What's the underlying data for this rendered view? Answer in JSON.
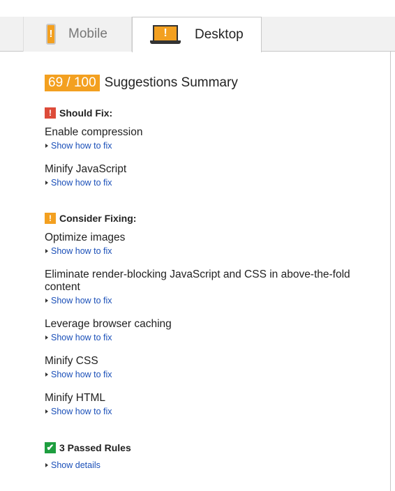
{
  "tabs": [
    {
      "label": "Mobile",
      "icon": "phone-warning-icon",
      "active": false
    },
    {
      "label": "Desktop",
      "icon": "laptop-warning-icon",
      "active": true
    }
  ],
  "summary": {
    "score": "69 / 100",
    "title": "Suggestions Summary"
  },
  "should_fix": {
    "heading": "Should Fix:",
    "badge": "!",
    "rules": [
      {
        "title": "Enable compression",
        "link": "Show how to fix"
      },
      {
        "title": "Minify JavaScript",
        "link": "Show how to fix"
      }
    ]
  },
  "consider_fixing": {
    "heading": "Consider Fixing:",
    "badge": "!",
    "rules": [
      {
        "title": "Optimize images",
        "link": "Show how to fix"
      },
      {
        "title": "Eliminate render-blocking JavaScript and CSS in above-the-fold content",
        "link": "Show how to fix"
      },
      {
        "title": "Leverage browser caching",
        "link": "Show how to fix"
      },
      {
        "title": "Minify CSS",
        "link": "Show how to fix"
      },
      {
        "title": "Minify HTML",
        "link": "Show how to fix"
      }
    ]
  },
  "passed": {
    "heading": "3 Passed Rules",
    "badge": "✔",
    "link": "Show details"
  },
  "colors": {
    "score_bg": "#f3a020",
    "should_fix": "#dd4b39",
    "consider": "#f3a020",
    "passed": "#1e9e3f",
    "link": "#1a4fb8"
  }
}
